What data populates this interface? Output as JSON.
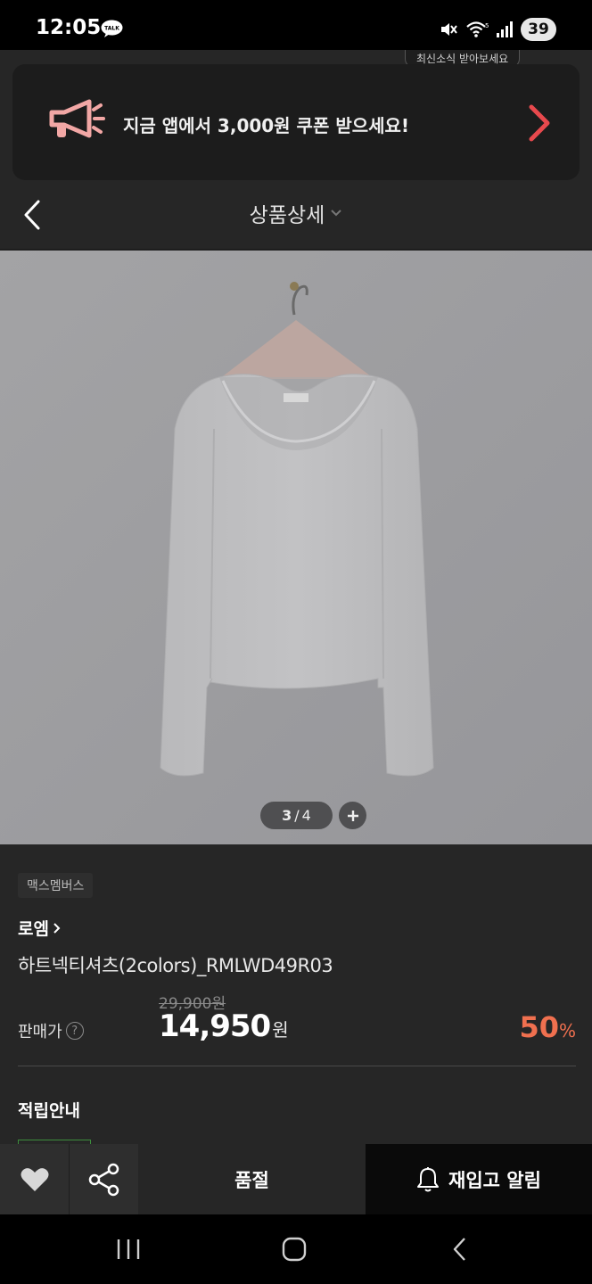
{
  "status_bar": {
    "time": "12:05",
    "talk_badge": "TALK",
    "battery": "39",
    "icons": [
      "kakaotalk-icon",
      "mute-icon",
      "wifi-icon",
      "signal-icon",
      "battery-icon"
    ]
  },
  "promo": {
    "news_chip": "최신소식 받아보세요",
    "text": "지금 앱에서 3,000원 쿠폰 받으세요!",
    "icon": "megaphone-icon",
    "arrow_icon": "chevron-right-icon",
    "colors": {
      "icon": "#f2a7a5",
      "arrow": "#e8494d"
    }
  },
  "header": {
    "title": "상품상세",
    "back_icon": "chevron-left-icon",
    "dropdown_icon": "chevron-down-icon"
  },
  "gallery": {
    "current": "3",
    "separator": "/",
    "total": "4",
    "zoom_icon": "plus-icon"
  },
  "product": {
    "membership_tag": "맥스멤버스",
    "brand": "로엠",
    "name": "하트넥티셔츠(2colors)_RMLWD49R03",
    "original_price": "29,900원",
    "price_label": "판매가",
    "help_glyph": "?",
    "sale_price": "14,950",
    "sale_unit": "원",
    "discount": "50",
    "discount_unit": "%",
    "points_title": "적립안내",
    "colors": {
      "discount": "#f0704f"
    }
  },
  "action_bar": {
    "like_icon": "heart-icon",
    "share_icon": "share-icon",
    "soldout_label": "품절",
    "restock_label": "재입고 알림",
    "bell_icon": "bell-icon"
  },
  "nav_bar": {
    "icons": [
      "recent-apps-icon",
      "home-icon",
      "back-icon"
    ]
  }
}
